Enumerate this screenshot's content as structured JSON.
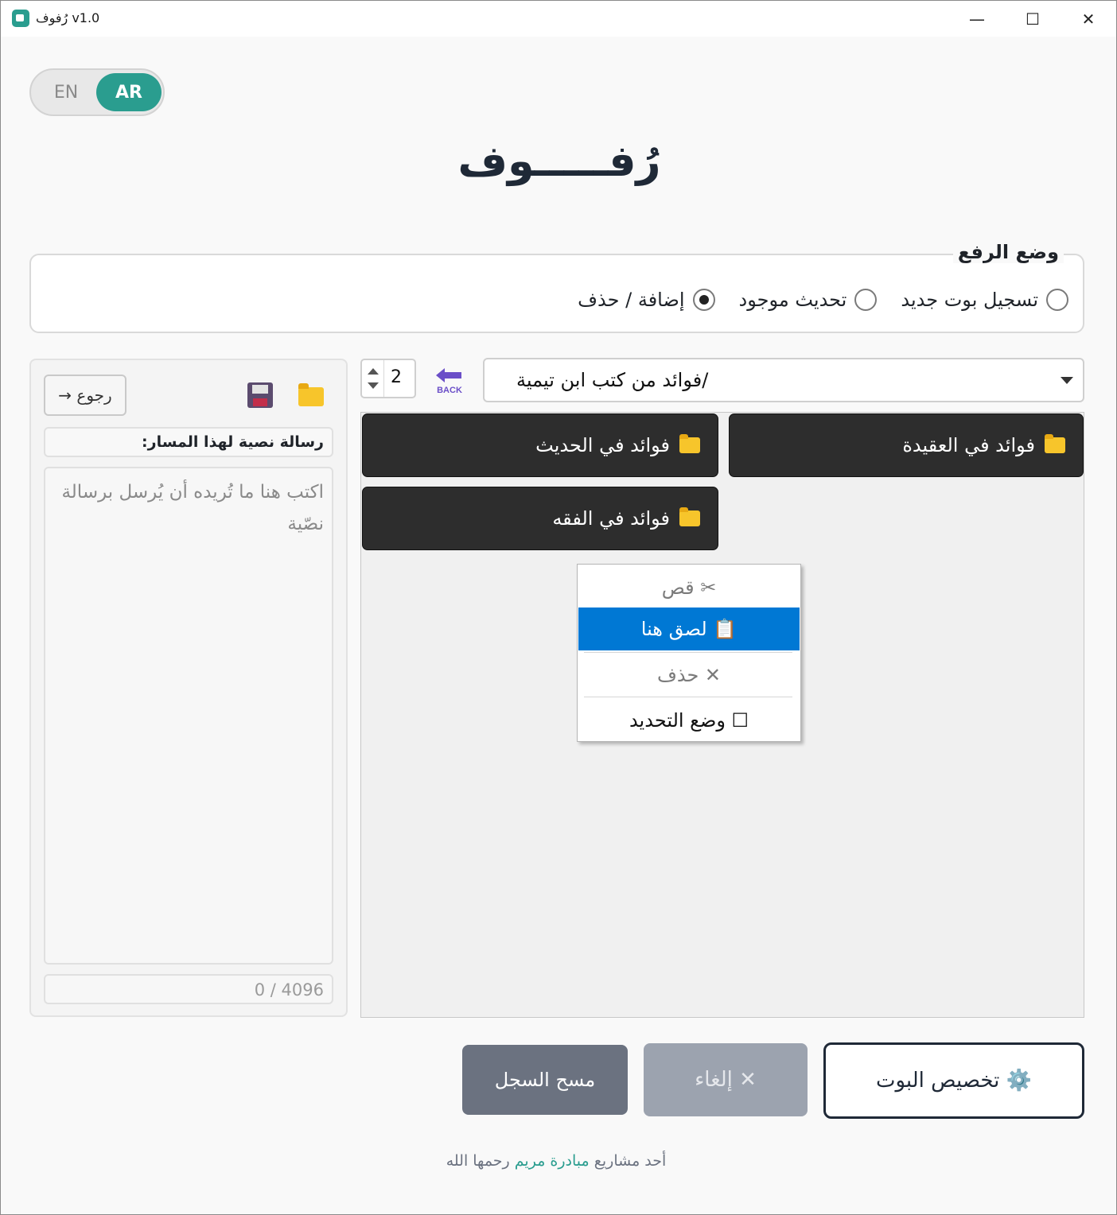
{
  "window": {
    "title": "رُفوف v1.0",
    "minimize_glyph": "—",
    "maximize_glyph": "☐",
    "close_glyph": "✕"
  },
  "language_toggle": {
    "en": "EN",
    "ar": "AR",
    "selected": "AR"
  },
  "app_title": "رُفـــــوف",
  "upload_mode": {
    "title": "وضع الرفع",
    "options": [
      {
        "label": "تسجيل بوت جديد",
        "checked": false
      },
      {
        "label": "تحديث موجود",
        "checked": false
      },
      {
        "label": "إضافة / حذف",
        "checked": true
      }
    ]
  },
  "left_panel": {
    "back_label": "→ رجوع",
    "folder_icon": "folder-icon",
    "save_icon": "floppy-disk-icon",
    "path_message_label": "رسالة نصية لهذا المسار:",
    "message_placeholder": "اكتب هنا ما تُريده أن يُرسل برسالة نصّية",
    "char_counter": "0 / 4096"
  },
  "navigation": {
    "columns_value": "2",
    "back_label": "BACK",
    "current_path": "/فوائد من كتب ابن تيمية"
  },
  "folders": [
    {
      "label": "فوائد في العقيدة"
    },
    {
      "label": "فوائد في الحديث"
    },
    {
      "label": "فوائد في الفقه"
    }
  ],
  "context_menu": {
    "cut": "✂ قص",
    "paste": "📋 لصق هنا",
    "delete": "✕ حذف",
    "select_mode": "☐ وضع التحديد",
    "active_item": "paste"
  },
  "buttons": {
    "clear_log": "مسح السجل",
    "cancel": "✕ إلغاء",
    "customize": "⚙️ تخصيص البوت"
  },
  "footer": {
    "prefix": "أحد مشاريع",
    "link": "مبادرة مريم",
    "suffix": "رحمها الله"
  },
  "colors": {
    "accent": "#2a9d8f",
    "menu_highlight": "#0078d4",
    "folder_button": "#2d2d2d"
  }
}
